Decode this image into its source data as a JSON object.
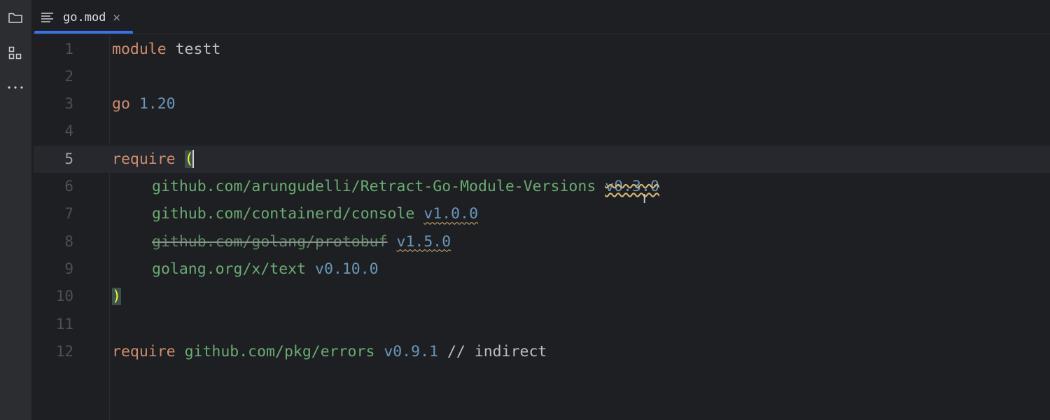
{
  "toolstrip": {
    "items": [
      {
        "name": "project",
        "icon": "folder-icon"
      },
      {
        "name": "structure",
        "icon": "structure-icon"
      },
      {
        "name": "more",
        "icon": "more-horizontal-icon"
      }
    ]
  },
  "tab": {
    "label": "go.mod",
    "close_glyph": "×",
    "accent": "#3574f0"
  },
  "editor": {
    "current_line": 5,
    "lines": [
      {
        "n": "1",
        "tokens": [
          {
            "t": "module",
            "c": "kw"
          },
          {
            "t": " testt",
            "c": "plain"
          }
        ]
      },
      {
        "n": "2",
        "tokens": []
      },
      {
        "n": "3",
        "tokens": [
          {
            "t": "go",
            "c": "kw"
          },
          {
            "t": " ",
            "c": "plain"
          },
          {
            "t": "1.20",
            "c": "ver"
          }
        ]
      },
      {
        "n": "4",
        "tokens": []
      },
      {
        "n": "5",
        "tokens": [
          {
            "t": "require",
            "c": "kw"
          },
          {
            "t": " ",
            "c": "plain"
          },
          {
            "t": "(",
            "c": "match"
          }
        ]
      },
      {
        "n": "6",
        "indent": true,
        "tokens": [
          {
            "t": "github.com/arungudelli/Retract-Go-Module-Versions",
            "c": "path"
          },
          {
            "t": " ",
            "c": "plain"
          },
          {
            "t": "v0.3.0",
            "c": "ver wavy-strike"
          }
        ]
      },
      {
        "n": "7",
        "indent": true,
        "tokens": [
          {
            "t": "github.com/containerd/console",
            "c": "path"
          },
          {
            "t": " ",
            "c": "plain"
          },
          {
            "t": "v1.0.0",
            "c": "ver wavy"
          }
        ]
      },
      {
        "n": "8",
        "indent": true,
        "tokens": [
          {
            "t": "github.com/golang/protobuf",
            "c": "path strike"
          },
          {
            "t": " ",
            "c": "plain"
          },
          {
            "t": "v1.5.0",
            "c": "ver wavy"
          }
        ]
      },
      {
        "n": "9",
        "indent": true,
        "tokens": [
          {
            "t": "golang.org/x/text",
            "c": "path"
          },
          {
            "t": " ",
            "c": "plain"
          },
          {
            "t": "v0.10.0",
            "c": "ver"
          }
        ]
      },
      {
        "n": "10",
        "tokens": [
          {
            "t": ")",
            "c": "match"
          }
        ]
      },
      {
        "n": "11",
        "tokens": []
      },
      {
        "n": "12",
        "tokens": [
          {
            "t": "require",
            "c": "kw"
          },
          {
            "t": " ",
            "c": "plain"
          },
          {
            "t": "github.com/pkg/errors",
            "c": "path"
          },
          {
            "t": " ",
            "c": "plain"
          },
          {
            "t": "v0.9.1",
            "c": "ver"
          },
          {
            "t": " // indirect",
            "c": "plain"
          }
        ]
      }
    ]
  },
  "colors": {
    "background": "#1e1f22",
    "keyword": "#cf8e6d",
    "module_path": "#6aab73",
    "version": "#6897bb",
    "warning_underline": "#d5b778",
    "bracket_match": "#3b514d"
  }
}
